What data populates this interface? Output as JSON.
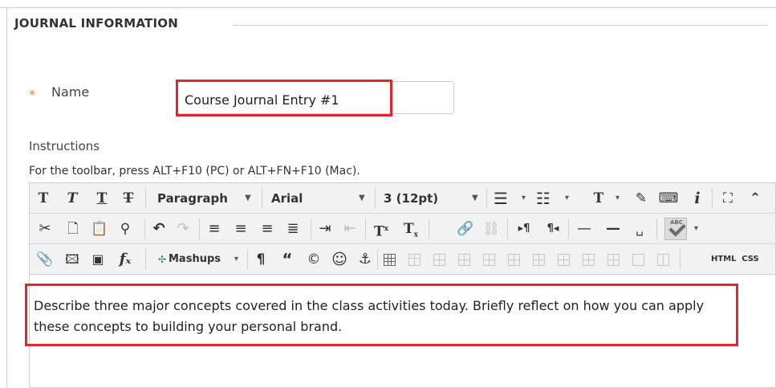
{
  "section": {
    "title": "JOURNAL INFORMATION"
  },
  "name_field": {
    "required_mark": "*",
    "label": "Name",
    "value": "Course Journal Entry #1"
  },
  "instructions": {
    "label": "Instructions",
    "toolbar_hint": "For the toolbar, press ALT+F10 (PC) or ALT+FN+F10 (Mac)."
  },
  "toolbar": {
    "row1": {
      "bold": "T",
      "italic": "T",
      "underline": "T",
      "strike": "T",
      "format_select": "Paragraph",
      "font_select": "Arial",
      "size_select": "3 (12pt)",
      "text_color": "T"
    },
    "row2": {
      "superscript": "T",
      "subscript": "T"
    },
    "row3": {
      "mashups": "Mashups",
      "pilcrow": "¶",
      "quote": "“",
      "copyright": "©",
      "html": "HTML",
      "css": "CSS"
    }
  },
  "editor": {
    "content": "Describe three major concepts covered in the class activities today. Briefly reflect on how you can apply these concepts to building your personal brand."
  },
  "colors": {
    "highlight": "#e0272f",
    "required": "#e3833a",
    "toolbar_bg": "#f2f2f2"
  }
}
